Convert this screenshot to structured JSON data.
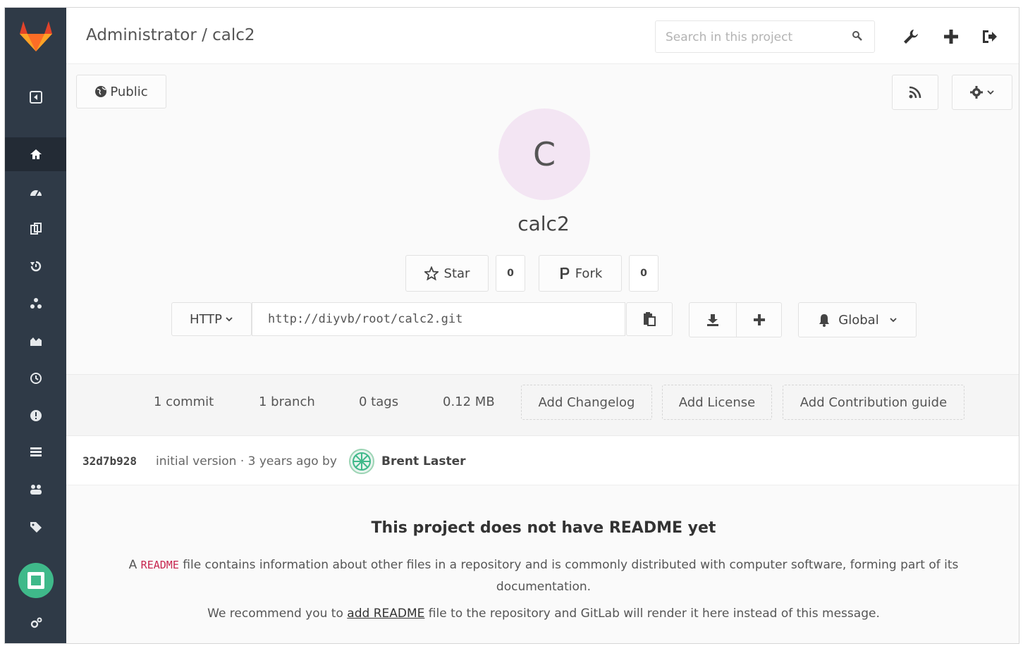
{
  "header": {
    "breadcrumb": "Administrator / calc2",
    "search_placeholder": "Search in this project"
  },
  "project": {
    "visibility": "Public",
    "avatar_letter": "C",
    "name": "calc2",
    "star_label": "Star",
    "star_count": "0",
    "fork_label": "Fork",
    "fork_count": "0",
    "protocol": "HTTP",
    "clone_url": "http://diyvb/root/calc2.git",
    "notification": "Global"
  },
  "stats": {
    "commits": "1 commit",
    "branches": "1 branch",
    "tags": "0 tags",
    "size": "0.12 MB",
    "add_changelog": "Add Changelog",
    "add_license": "Add License",
    "add_contribution": "Add Contribution guide"
  },
  "commit": {
    "sha": "32d7b928",
    "message": "initial version · 3 years ago by",
    "author": "Brent Laster"
  },
  "readme": {
    "title": "This project does not have README yet",
    "text_prefix": "A",
    "keyword": "README",
    "text_suffix": "file contains information about other files in a repository and is commonly distributed with computer software, forming part of its documentation.",
    "rec_prefix": "We recommend you to",
    "rec_link": "add README",
    "rec_suffix": "file to the repository and GitLab will render it here instead of this message."
  },
  "colors": {
    "sidebar": "#2f3a47",
    "logo_orange": "#e2432a",
    "avatar_bg": "#f3e5f3",
    "readme_keyword": "#c7254e"
  },
  "icons": [
    "gitlab-logo-icon",
    "collapse-icon",
    "home-icon",
    "activity-icon",
    "files-icon",
    "commits-icon",
    "network-icon",
    "graphs-icon",
    "milestones-icon",
    "issues-icon",
    "merge-requests-icon",
    "members-icon",
    "labels-icon",
    "user-avatar-icon",
    "settings-icon",
    "search-icon",
    "wrench-icon",
    "plus-icon",
    "sign-out-icon",
    "globe-icon",
    "rss-icon",
    "gear-icon",
    "star-icon",
    "fork-icon",
    "clipboard-icon",
    "download-icon",
    "bell-icon",
    "chevron-down-icon"
  ]
}
